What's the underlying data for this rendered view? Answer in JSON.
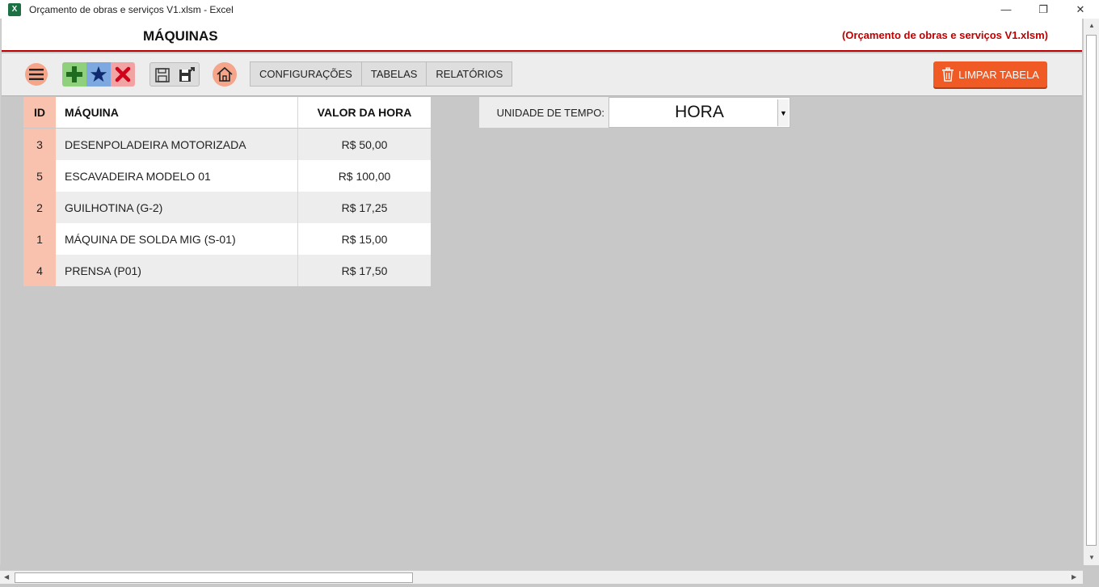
{
  "window": {
    "app_icon": "X",
    "title": "Orçamento de obras e serviços V1.xlsm - Excel",
    "minimize": "—",
    "restore": "❐",
    "close": "✕"
  },
  "header": {
    "page_title": "MÁQUINAS",
    "file_label": "(Orçamento de obras e serviços V1.xlsm)"
  },
  "toolbar": {
    "nav": [
      "CONFIGURAÇÕES",
      "TABELAS",
      "RELATÓRIOS"
    ],
    "limpar_label": "LIMPAR TABELA",
    "icons": {
      "menu": "hamburger-menu-icon",
      "add": "plus-icon",
      "favorite": "star-icon",
      "delete": "x-icon",
      "save": "floppy-disk-icon",
      "export": "floppy-export-icon",
      "home": "home-icon",
      "trash": "trash-icon"
    },
    "colors": {
      "accent_red": "#c00000",
      "limpar_bg": "#f05a24",
      "id_col_bg": "#f8c2ae",
      "add_bg": "#8fd07c",
      "star_bg": "#7ea8e0",
      "delete_bg": "#f2a3a3"
    }
  },
  "table": {
    "headers": {
      "id": "ID",
      "name": "MÁQUINA",
      "value": "VALOR DA HORA"
    },
    "rows": [
      {
        "id": "3",
        "name": "DESENPOLADEIRA MOTORIZADA",
        "value": "R$ 50,00"
      },
      {
        "id": "5",
        "name": "ESCAVADEIRA MODELO 01",
        "value": "R$ 100,00"
      },
      {
        "id": "2",
        "name": "GUILHOTINA (G-2)",
        "value": "R$ 17,25"
      },
      {
        "id": "1",
        "name": "MÁQUINA DE SOLDA MIG (S-01)",
        "value": "R$ 15,00"
      },
      {
        "id": "4",
        "name": "PRENSA (P01)",
        "value": "R$ 17,50"
      }
    ]
  },
  "unit": {
    "label": "UNIDADE DE TEMPO:",
    "value": "HORA",
    "dropdown_arrow": "▼"
  },
  "scroll": {
    "up": "▲",
    "down": "▼",
    "left": "◀",
    "right": "▶"
  }
}
